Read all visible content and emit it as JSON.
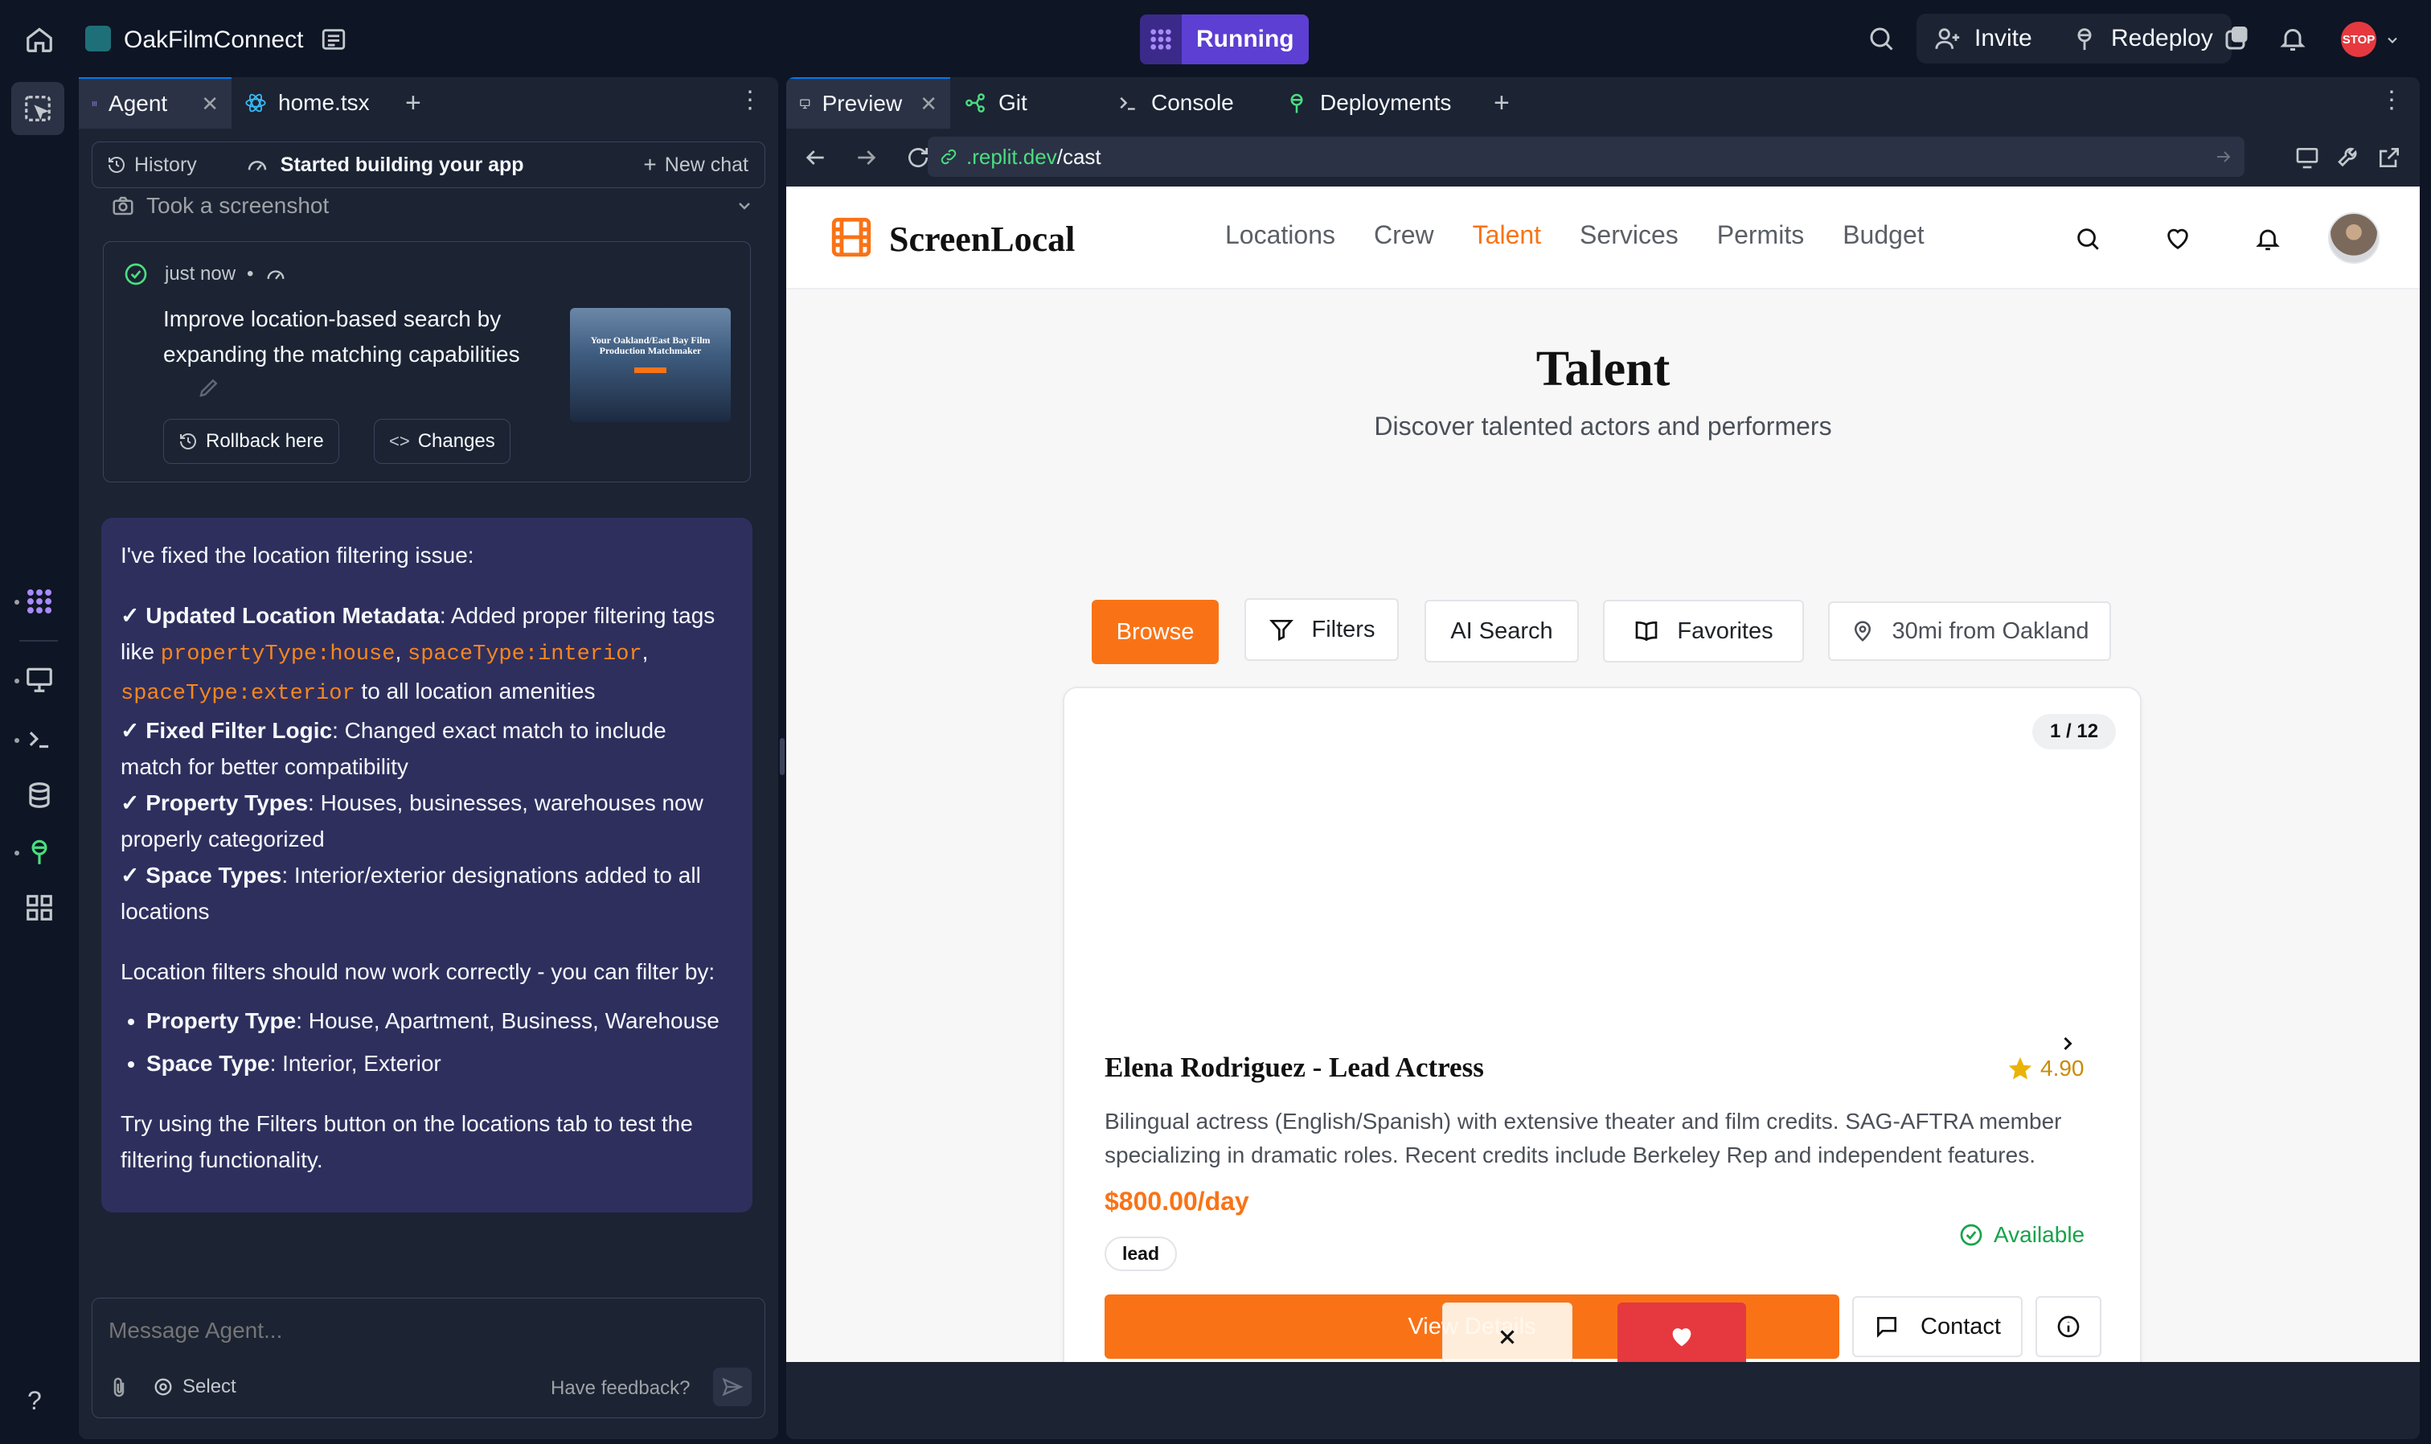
{
  "topbar": {
    "project_name": "OakFilmConnect",
    "status": "Running",
    "invite_label": "Invite",
    "redeploy_label": "Redeploy",
    "stop_badge": "STOP"
  },
  "agent_pane": {
    "tabs": [
      {
        "label": "Agent",
        "icon": "agent-icon",
        "active": true
      },
      {
        "label": "home.tsx",
        "icon": "react-icon",
        "active": false
      }
    ],
    "history_label": "History",
    "thread_title": "Started building your app",
    "new_chat_label": "New chat",
    "screenshot_label": "Took a screenshot",
    "checkpoint": {
      "time": "just now",
      "title": "Improve location-based search by expanding the matching capabilities",
      "rollback_label": "Rollback here",
      "changes_label": "Changes",
      "thumb_text": "Your Oakland/East Bay Film Production Matchmaker"
    },
    "message": {
      "intro": "I've fixed the location filtering issue:",
      "items": [
        {
          "bold": "Updated Location Metadata",
          "text1": ": Added proper filtering tags like ",
          "code1": "propertyType:house",
          "sep1": ", ",
          "code2": "spaceType:interior",
          "sep2": ", ",
          "code3": "spaceType:exterior",
          "text2": " to all location amenities"
        },
        {
          "bold": "Fixed Filter Logic",
          "text": ": Changed exact match to include match for better compatibility"
        },
        {
          "bold": "Property Types",
          "text": ": Houses, businesses, warehouses now properly categorized"
        },
        {
          "bold": "Space Types",
          "text": ": Interior/exterior designations added to all locations"
        }
      ],
      "check": "✓",
      "filters_intro": "Location filters should now work correctly - you can filter by:",
      "bullets": [
        {
          "bold": "Property Type",
          "text": ": House, Apartment, Business, Warehouse"
        },
        {
          "bold": "Space Type",
          "text": ": Interior, Exterior"
        }
      ],
      "outro": "Try using the Filters button on the locations tab to test the filtering functionality."
    },
    "input_placeholder": "Message Agent...",
    "select_label": "Select",
    "feedback_label": "Have feedback?"
  },
  "preview_pane": {
    "tabs": [
      {
        "label": "Preview",
        "icon": "monitor-icon",
        "active": true
      },
      {
        "label": "Git",
        "icon": "git-icon",
        "active": false
      },
      {
        "label": "Console",
        "icon": "terminal-icon",
        "active": false
      },
      {
        "label": "Deployments",
        "icon": "deploy-icon",
        "active": false
      }
    ],
    "url_domain": ".replit.dev",
    "url_path": "/cast"
  },
  "site": {
    "brand": "ScreenLocal",
    "nav": [
      "Locations",
      "Crew",
      "Talent",
      "Services",
      "Permits",
      "Budget"
    ],
    "active_nav": "Talent",
    "heading": "Talent",
    "subheading": "Discover talented actors and performers",
    "browse_label": "Browse",
    "filters_label": "Filters",
    "ai_search_label": "AI Search",
    "favorites_label": "Favorites",
    "location_label": "30mi from Oakland",
    "card": {
      "counter": "1 / 12",
      "name": "Elena Rodriguez - Lead Actress",
      "rating": "4.90",
      "description": "Bilingual actress (English/Spanish) with extensive theater and film credits. SAG-AFTRA member specializing in dramatic roles. Recent credits include Berkeley Rep and independent features.",
      "price": "$800.00/day",
      "availability": "Available",
      "tag": "lead",
      "view_details_label": "View Details",
      "contact_label": "Contact"
    }
  },
  "colors": {
    "accent_orange": "#f97316",
    "replit_purple": "#5d3fd3",
    "heart_red": "#e5393f",
    "available_green": "#16a34a",
    "star_gold": "#eab308",
    "code_orange": "#f7871e"
  }
}
